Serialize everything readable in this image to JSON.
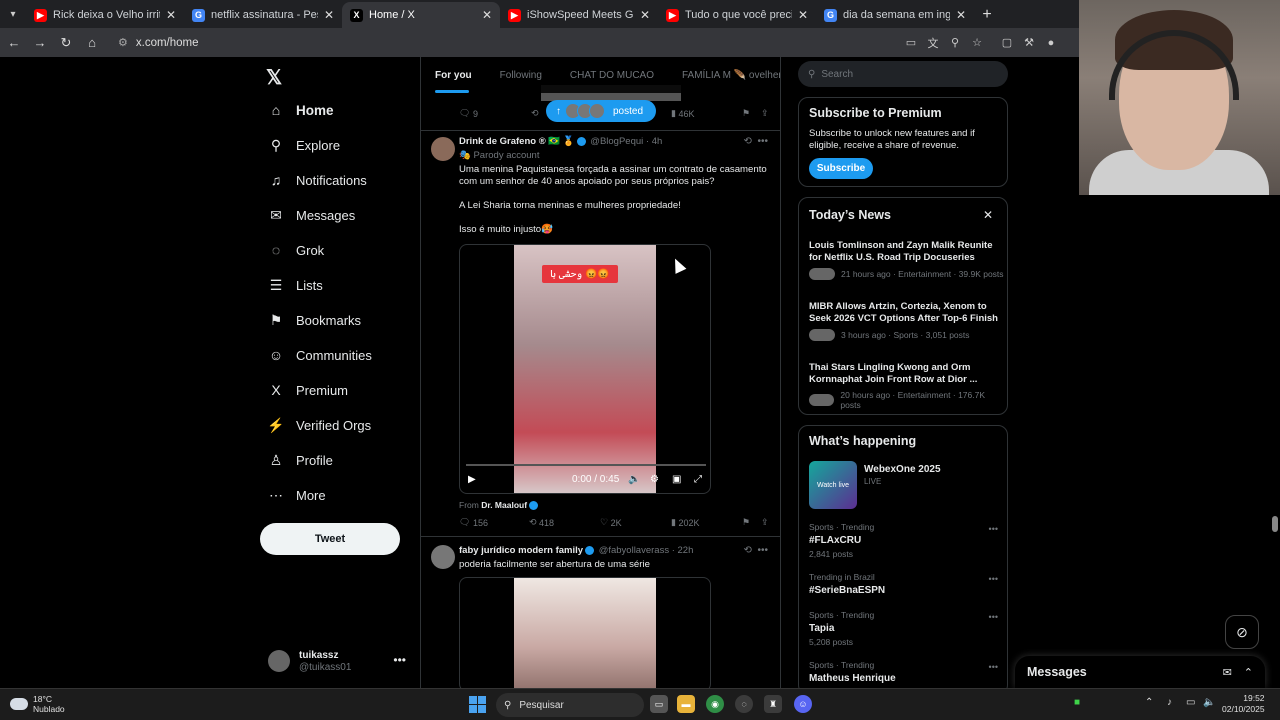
{
  "browser": {
    "tabs": [
      {
        "title": "Rick deixa o Velho irritado após",
        "color": "#ff0000",
        "glyph": "▶"
      },
      {
        "title": "netflix assinatura - Pesquisa Go",
        "color": "#4285f4",
        "glyph": "G"
      },
      {
        "title": "Home / X",
        "color": "#000000",
        "glyph": "X",
        "active": true
      },
      {
        "title": "iShowSpeed Meets Gigachad In",
        "color": "#ff0000",
        "glyph": "▶"
      },
      {
        "title": "Tudo o que você precisa saber",
        "color": "#ff0000",
        "glyph": "▶"
      },
      {
        "title": "dia da semana em ingles - Pesq",
        "color": "#4285f4",
        "glyph": "G"
      }
    ],
    "url": "x.com/home"
  },
  "nav": {
    "items": [
      {
        "label": "Home",
        "icon": "home-icon",
        "glyph": "⌂"
      },
      {
        "label": "Explore",
        "icon": "search-icon",
        "glyph": "⚲"
      },
      {
        "label": "Notifications",
        "icon": "bell-icon",
        "glyph": "♫"
      },
      {
        "label": "Messages",
        "icon": "envelope-icon",
        "glyph": "✉"
      },
      {
        "label": "Grok",
        "icon": "grok-icon",
        "glyph": "◌"
      },
      {
        "label": "Lists",
        "icon": "list-icon",
        "glyph": "☰"
      },
      {
        "label": "Bookmarks",
        "icon": "bookmark-icon",
        "glyph": "⚑"
      },
      {
        "label": "Communities",
        "icon": "people-icon",
        "glyph": "☺"
      },
      {
        "label": "Premium",
        "icon": "x-logo-icon",
        "glyph": "X"
      },
      {
        "label": "Verified Orgs",
        "icon": "lightning-icon",
        "glyph": "⚡"
      },
      {
        "label": "Profile",
        "icon": "person-icon",
        "glyph": "♙"
      },
      {
        "label": "More",
        "icon": "more-circle-icon",
        "glyph": "⋯"
      }
    ],
    "tweet_label": "Tweet",
    "account": {
      "name": "tuikassz",
      "handle": "@tuikass01"
    }
  },
  "feed": {
    "tabs": [
      "For you",
      "Following",
      "CHAT DO MUCAO",
      "FAMÍLIA M 🪶 ovelhera"
    ],
    "posted_label": "posted",
    "prev_actions": {
      "replies": "9",
      "likes": "46K"
    },
    "post1": {
      "name": "Drink de Grafeno ® 🇧🇷 🏅",
      "handle": "@BlogPequi · 4h",
      "parody": "🎭 Parody account",
      "text1": "Uma menina Paquistanesa forçada a assinar um contrato de casamento com um senhor de 40 anos apoiado por seus próprios pais?",
      "text2": "A Lei Sharia torna meninas e mulheres propriedade!",
      "text3": "Isso é muito injusto🥵",
      "video_caption": "وحشی ہا 😡😡",
      "video_time": "0:00 / 0:45",
      "from_label": "From",
      "from_name": "Dr. Maalouf",
      "replies": "156",
      "reposts": "418",
      "likes": "2K",
      "views": "202K"
    },
    "post2": {
      "name": "faby jurídico modern family",
      "handle": "@fabyollaverass · 22h",
      "text": "poderia facilmente ser abertura de uma série"
    }
  },
  "sidebar": {
    "search_placeholder": "Search",
    "premium": {
      "title": "Subscribe to Premium",
      "text": "Subscribe to unlock new features and if eligible, receive a share of revenue.",
      "button": "Subscribe"
    },
    "news": {
      "title": "Today’s News",
      "items": [
        {
          "title": "Louis Tomlinson and Zayn Malik Reunite for Netflix U.S. Road Trip Docuseries",
          "meta": "21 hours ago · Entertainment · 39.9K posts"
        },
        {
          "title": "MIBR Allows Artzin, Cortezia, Xenom to Seek 2026 VCT Options After Top-6 Finish",
          "meta": "3 hours ago · Sports · 3,051 posts"
        },
        {
          "title": "Thai Stars Lingling Kwong and Orm Kornnaphat Join Front Row at Dior ...",
          "meta": "20 hours ago · Entertainment · 176.7K posts"
        }
      ]
    },
    "happening": {
      "title": "What’s happening",
      "event": {
        "title": "WebexOne 2025",
        "status": "LIVE",
        "thumb": "Watch live"
      },
      "trends": [
        {
          "context": "Sports · Trending",
          "topic": "#FLAxCRU",
          "posts": "2,841 posts"
        },
        {
          "context": "Trending in Brazil",
          "topic": "#SerieBnaESPN",
          "posts": ""
        },
        {
          "context": "Sports · Trending",
          "topic": "Tapia",
          "posts": "5,208 posts"
        },
        {
          "context": "Sports · Trending",
          "topic": "Matheus Henrique",
          "posts": ""
        }
      ]
    }
  },
  "messages_drawer": {
    "title": "Messages"
  },
  "taskbar": {
    "temp": "18°C",
    "condition": "Nublado",
    "search": "Pesquisar",
    "time": "19:52",
    "date": "02/10/2025"
  }
}
